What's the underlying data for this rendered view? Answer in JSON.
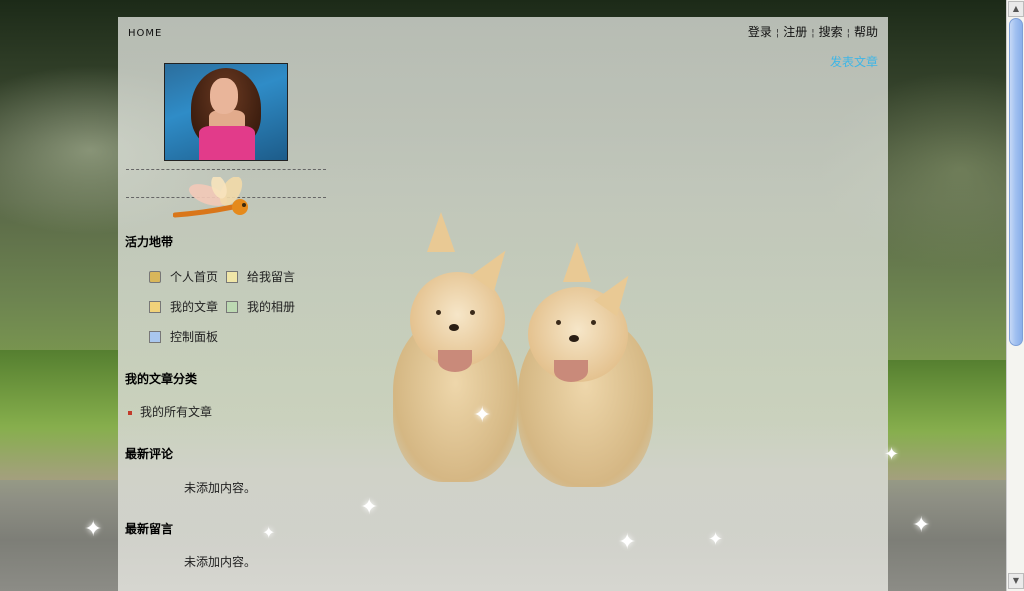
{
  "nav": {
    "home": "HOME",
    "links": [
      "登录",
      "注册",
      "搜索",
      "帮助"
    ],
    "separator": "¦",
    "post_article": "发表文章"
  },
  "profile": {
    "name": "活力地带",
    "menu": [
      {
        "label": "个人首页",
        "icon": "home-icon"
      },
      {
        "label": "给我留言",
        "icon": "message-icon"
      },
      {
        "label": "我的文章",
        "icon": "article-edit-icon"
      },
      {
        "label": "我的相册",
        "icon": "photo-album-icon"
      },
      {
        "label": "控制面板",
        "icon": "control-panel-icon"
      }
    ]
  },
  "categories": {
    "title": "我的文章分类",
    "items": [
      "我的所有文章"
    ]
  },
  "latest_comments": {
    "title": "最新评论",
    "empty_text": "未添加内容。"
  },
  "latest_messages": {
    "title": "最新留言",
    "empty_text": "未添加内容。"
  },
  "colors": {
    "link_accent": "#3fb6e6",
    "bullet": "#c23a2a"
  }
}
